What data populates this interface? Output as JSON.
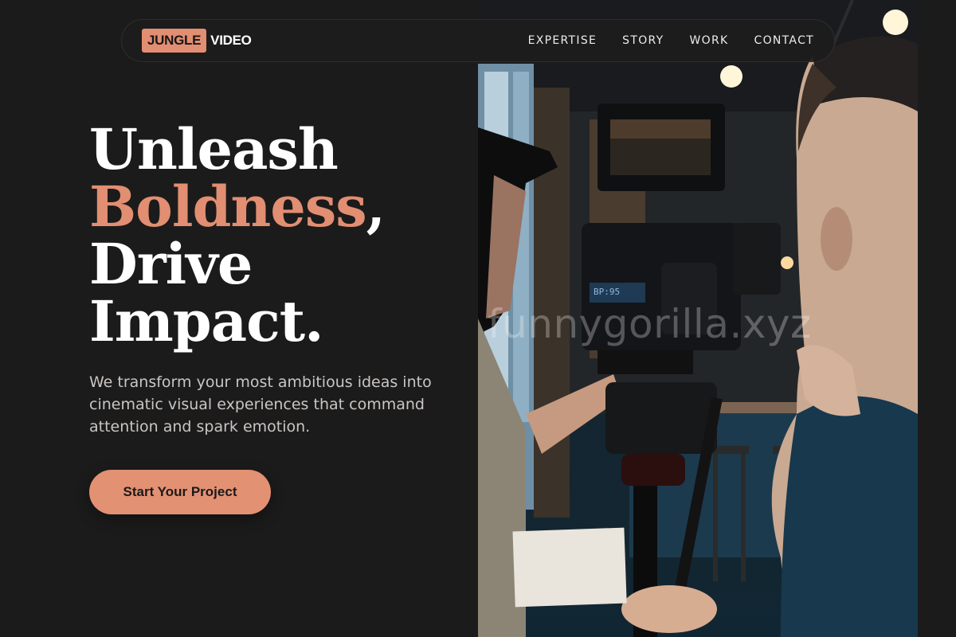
{
  "brand": {
    "logo_box_text": "JUNGLE",
    "logo_text": "VIDEO",
    "accent_color": "#e28e72"
  },
  "nav": {
    "links": [
      {
        "label": "EXPERTISE"
      },
      {
        "label": "STORY"
      },
      {
        "label": "WORK"
      },
      {
        "label": "CONTACT"
      }
    ]
  },
  "hero": {
    "headline_line1": "Unleash",
    "headline_accent": "Boldness",
    "headline_comma": ",",
    "headline_line3": "Drive",
    "headline_line4": "Impact.",
    "subtext": "We transform your most ambitious ideas into cinematic visual experiences that command attention and spark emotion.",
    "cta_label": "Start Your Project",
    "photo_watermark": "funnygorilla.xyz",
    "monitor_readout": "BP:95"
  }
}
